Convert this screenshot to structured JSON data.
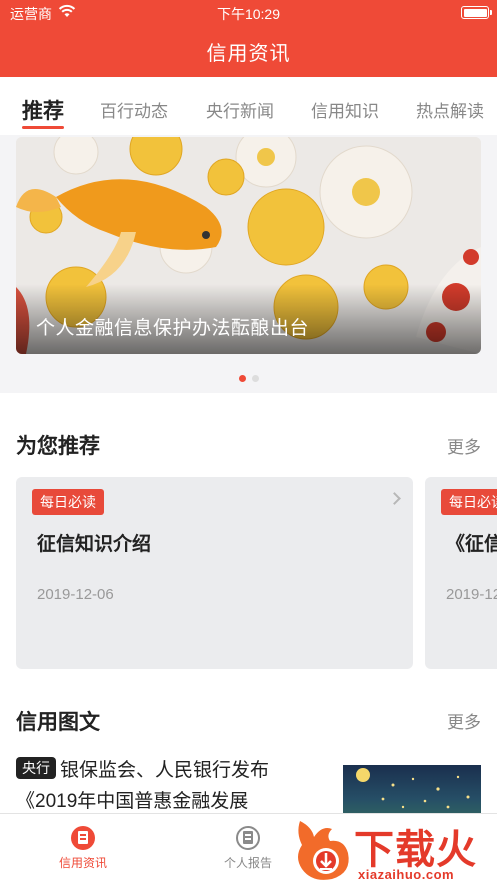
{
  "status": {
    "carrier": "运营商",
    "time": "下午10:29"
  },
  "nav": {
    "title": "信用资讯"
  },
  "tabs": [
    {
      "label": "推荐",
      "active": true
    },
    {
      "label": "百行动态"
    },
    {
      "label": "央行新闻"
    },
    {
      "label": "信用知识"
    },
    {
      "label": "热点解读"
    }
  ],
  "banner": {
    "caption": "个人金融信息保护办法酝酿出台",
    "pages": 2,
    "current": 1
  },
  "recommend": {
    "title": "为您推荐",
    "more": "更多",
    "cards": [
      {
        "tag": "每日必读",
        "title": "征信知识介绍",
        "date": "2019-12-06"
      },
      {
        "tag": "每日必读",
        "title": "《征信",
        "date": "2019-12"
      }
    ]
  },
  "graphic": {
    "title": "信用图文",
    "more": "更多",
    "article": {
      "badge": "央行",
      "title": "银保监会、人民银行发布《2019年中国普惠金融发展"
    }
  },
  "tabbar": [
    {
      "label": "信用资讯",
      "active": true
    },
    {
      "label": "个人报告",
      "active": false
    }
  ],
  "watermark": {
    "main": "下载火",
    "sub": "xiazaihuo.com"
  },
  "colors": {
    "brand": "#ef4a37",
    "tag": "#e84a3a"
  }
}
